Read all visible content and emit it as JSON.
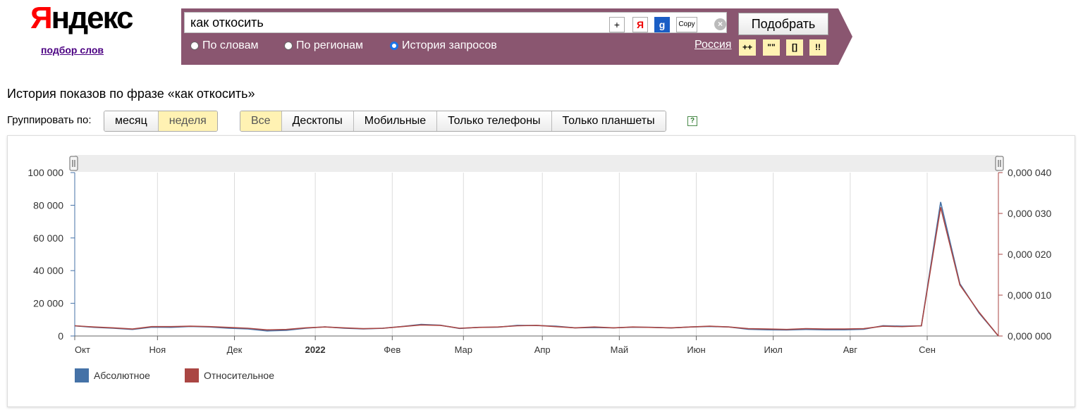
{
  "logo": {
    "text_first": "Я",
    "text_rest": "ндекс",
    "subtitle": "подбор слов"
  },
  "search": {
    "value": "как откосить",
    "plus_label": "+",
    "yandex_label": "Я",
    "google_label": "g",
    "copy_label": "Copy",
    "submit_label": "Подобрать"
  },
  "modes": [
    {
      "label": "По словам",
      "selected": false
    },
    {
      "label": "По регионам",
      "selected": false
    },
    {
      "label": "История запросов",
      "selected": true
    }
  ],
  "region": "Россия",
  "operators": [
    "++",
    "\"\"",
    "[]",
    "!!"
  ],
  "title": "История показов по фразе «как откосить»",
  "group_by": {
    "label": "Группировать по:",
    "options": [
      {
        "label": "месяц",
        "active": false
      },
      {
        "label": "неделя",
        "active": true
      }
    ]
  },
  "devices": [
    {
      "label": "Все",
      "active": true
    },
    {
      "label": "Десктопы",
      "active": false
    },
    {
      "label": "Мобильные",
      "active": false
    },
    {
      "label": "Только телефоны",
      "active": false
    },
    {
      "label": "Только планшеты",
      "active": false
    }
  ],
  "help": "?",
  "chart_data": {
    "type": "line",
    "y_ticks": [
      "0",
      "20 000",
      "40 000",
      "60 000",
      "80 000",
      "100 000"
    ],
    "y_range": [
      0,
      100000
    ],
    "y2_ticks": [
      "0,000 000",
      "0,000 010",
      "0,000 020",
      "0,000 030",
      "0,000 040"
    ],
    "y2_range": [
      0,
      4e-05
    ],
    "x_ticks": [
      "Окт",
      "Ноя",
      "Дек",
      "2022",
      "Фев",
      "Мар",
      "Апр",
      "Май",
      "Июн",
      "Июл",
      "Авг",
      "Сен"
    ],
    "x_tick_positions": [
      0,
      4.3,
      8.3,
      12.5,
      16.5,
      20.2,
      24.3,
      28.3,
      32.3,
      36.3,
      40.3,
      44.3
    ],
    "x_count": 49,
    "series": [
      {
        "name": "Абсолютное",
        "color": "#4572a7",
        "values": [
          6200,
          5300,
          4800,
          4000,
          5400,
          5300,
          5800,
          5500,
          4800,
          4300,
          3100,
          3500,
          4800,
          5600,
          4800,
          4300,
          4700,
          5800,
          7100,
          6600,
          4600,
          5300,
          5400,
          6500,
          6400,
          6000,
          5000,
          5200,
          5000,
          5400,
          5300,
          4900,
          5500,
          5800,
          5500,
          4100,
          3800,
          3700,
          4000,
          3800,
          3800,
          4100,
          6300,
          6000,
          6200,
          82000,
          32000,
          14000,
          0
        ]
      },
      {
        "name": "Относительное",
        "color": "#aa4643",
        "values": [
          2.5e-06,
          2.2e-06,
          2e-06,
          1.7e-06,
          2.3e-06,
          2.3e-06,
          2.4e-06,
          2.3e-06,
          2.1e-06,
          1.9e-06,
          1.5e-06,
          1.6e-06,
          2e-06,
          2.2e-06,
          2e-06,
          1.8e-06,
          1.9e-06,
          2.3e-06,
          2.7e-06,
          2.6e-06,
          1.9e-06,
          2.1e-06,
          2.2e-06,
          2.5e-06,
          2.6e-06,
          2.3e-06,
          2e-06,
          2.2e-06,
          2e-06,
          2.2e-06,
          2.1e-06,
          2e-06,
          2.2e-06,
          2.4e-06,
          2.2e-06,
          1.8e-06,
          1.7e-06,
          1.6e-06,
          1.8e-06,
          1.7e-06,
          1.7e-06,
          1.8e-06,
          2.4e-06,
          2.3e-06,
          2.5e-06,
          3.15e-05,
          1.25e-05,
          5.8e-06,
          0
        ]
      }
    ]
  }
}
